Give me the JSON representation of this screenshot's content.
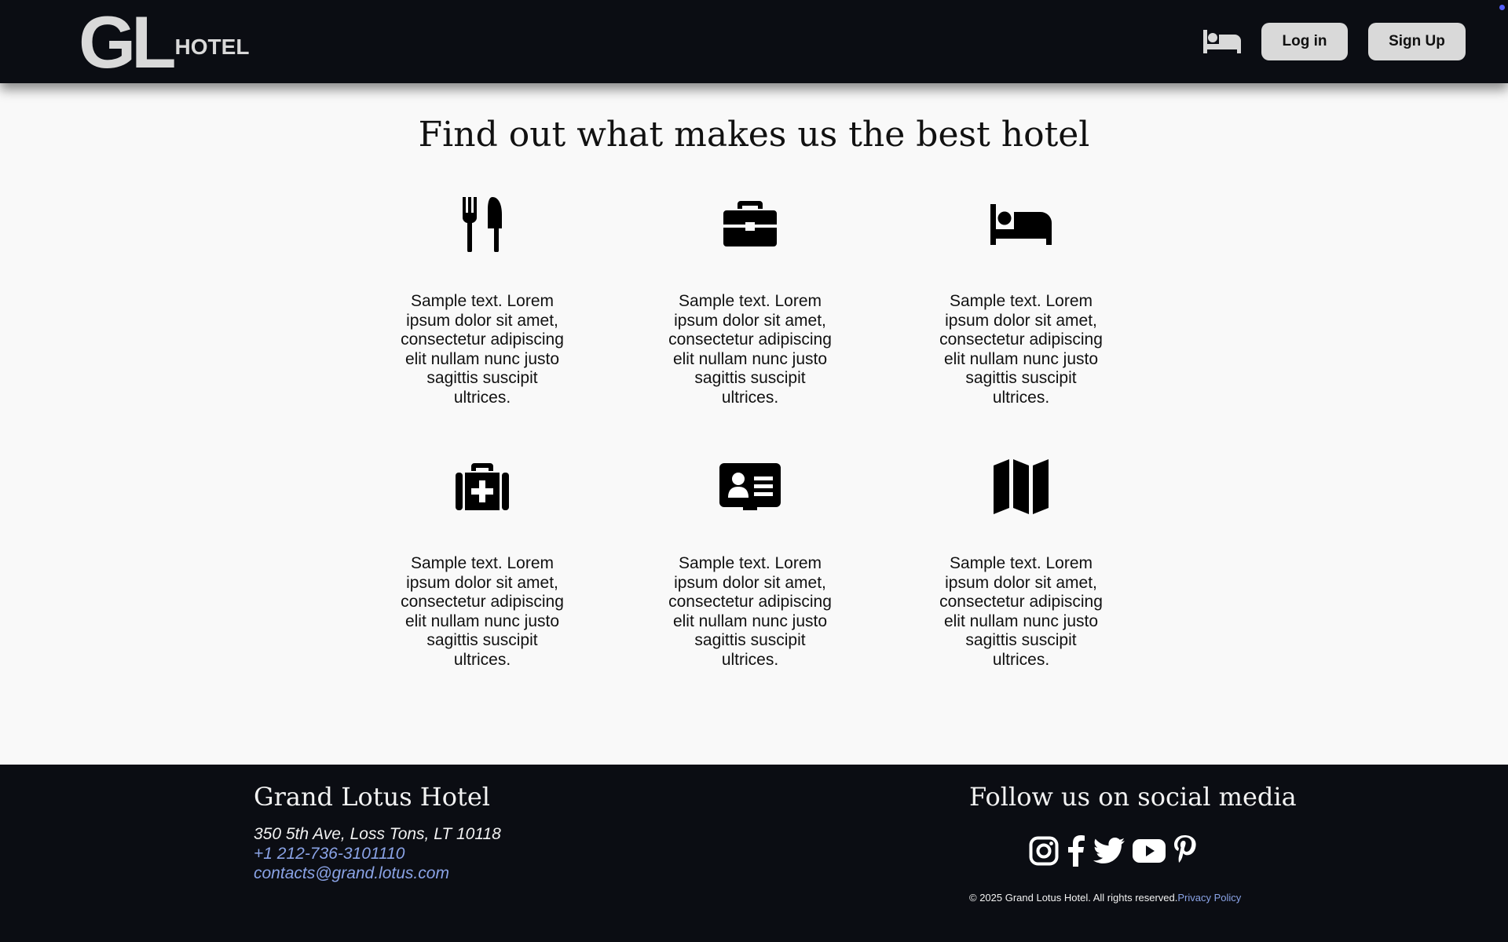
{
  "header": {
    "logo_main": "GL",
    "logo_sub": "HOTEL",
    "bed_icon": "bed-icon",
    "login_label": "Log in",
    "signup_label": "Sign Up"
  },
  "main": {
    "title": "Find out what makes us the best hotel",
    "features": [
      {
        "icon": "utensils-icon",
        "text": "Sample text. Lorem ipsum dolor sit amet, consectetur adipiscing elit nullam nunc justo sagittis suscipit ultrices."
      },
      {
        "icon": "briefcase-icon",
        "text": "Sample text. Lorem ipsum dolor sit amet, consectetur adipiscing elit nullam nunc justo sagittis suscipit ultrices."
      },
      {
        "icon": "bed-icon",
        "text": "Sample text. Lorem ipsum dolor sit amet, consectetur adipiscing elit nullam nunc justo sagittis suscipit ultrices."
      },
      {
        "icon": "medical-kit-icon",
        "text": "Sample text. Lorem ipsum dolor sit amet, consectetur adipiscing elit nullam nunc justo sagittis suscipit ultrices."
      },
      {
        "icon": "id-card-icon",
        "text": "Sample text. Lorem ipsum dolor sit amet, consectetur adipiscing elit nullam nunc justo sagittis suscipit ultrices."
      },
      {
        "icon": "map-icon",
        "text": "Sample text. Lorem ipsum dolor sit amet, consectetur adipiscing elit nullam nunc justo sagittis suscipit ultrices."
      }
    ]
  },
  "footer": {
    "hotel_name": "Grand Lotus Hotel",
    "address": "350 5th Ave, Loss Tons, LT 10118",
    "phone": "+1 212-736-3101110",
    "email": "contacts@grand.lotus.com",
    "social_title": "Follow us on social media",
    "social_icons": [
      "instagram-icon",
      "facebook-icon",
      "twitter-icon",
      "youtube-icon",
      "pinterest-icon"
    ],
    "copyright": "© 2025 Grand Lotus Hotel. All rights reserved.",
    "privacy_label": "Privacy Policy"
  },
  "colors": {
    "header_bg": "#0b0d13",
    "button_bg": "#d9d9d9",
    "link": "#8aa3e6",
    "page_bg": "#f9f9f9"
  }
}
